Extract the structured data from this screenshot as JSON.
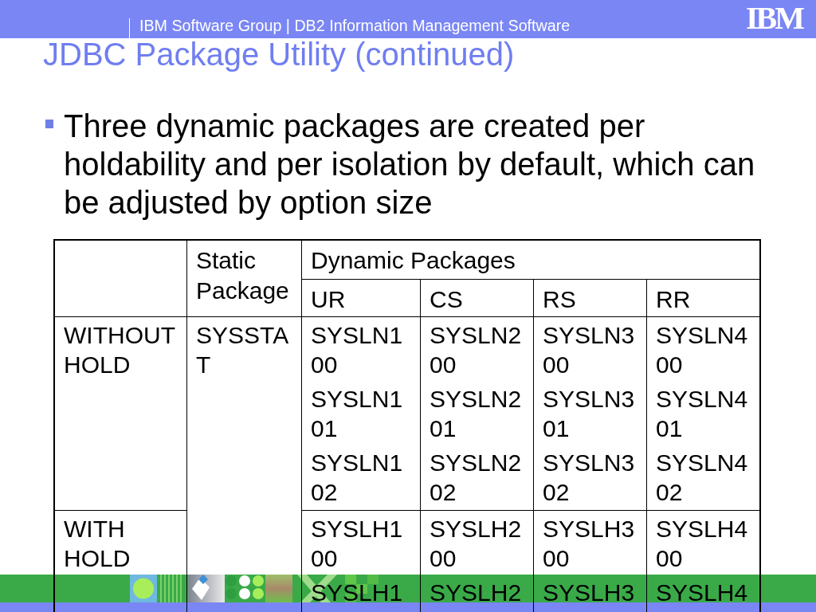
{
  "header_bar": {
    "text": "IBM Software Group | DB2 Information Management Software",
    "logo": "IBM"
  },
  "title": "JDBC Package Utility (continued)",
  "bullets": [
    "Three dynamic packages are created per holdability and per isolation by default, which can be adjusted by option size"
  ],
  "table": {
    "static_header": "Static Package",
    "dynamic_header": "Dynamic Packages",
    "isolation_levels": [
      "UR",
      "CS",
      "RS",
      "RR"
    ],
    "rows": [
      {
        "label": "WITHOUT HOLD",
        "static": "SYSSTAT",
        "dynamic": [
          [
            "SYSLN100",
            "SYSLN101",
            "SYSLN102"
          ],
          [
            "SYSLN200",
            "SYSLN201",
            "SYSLN202"
          ],
          [
            "SYSLN300",
            "SYSLN301",
            "SYSLN302"
          ],
          [
            "SYSLN400",
            "SYSLN401",
            "SYSLN402"
          ]
        ]
      },
      {
        "label": "WITH HOLD",
        "dynamic": [
          [
            "SYSLH100",
            "SYSLH1"
          ],
          [
            "SYSLH200",
            "SYSLH2"
          ],
          [
            "SYSLH300",
            "SYSLH3"
          ],
          [
            "SYSLH400",
            "SYSLH4"
          ]
        ]
      }
    ]
  }
}
